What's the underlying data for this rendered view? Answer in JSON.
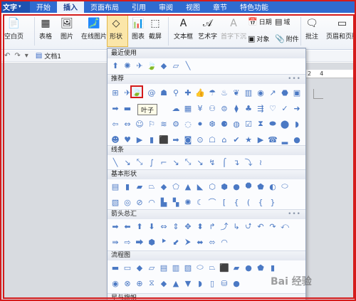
{
  "app_menu": {
    "label": "文字",
    "caret": "▾"
  },
  "menu_tabs": [
    "开始",
    "插入",
    "页面布局",
    "引用",
    "审阅",
    "视图",
    "章节",
    "特色功能"
  ],
  "active_tab": "插入",
  "ribbon": {
    "blank_page": "空白页",
    "table": "表格",
    "picture": "图片",
    "online_picture": "在线图片",
    "shape": "形状",
    "chart": "图表",
    "screenshot": "截屏",
    "textbox": "文本框",
    "art_text": "艺术字",
    "drop_cap": "首字下沉",
    "date": "日期",
    "object": "对象",
    "domain": "域",
    "attachment": "附件",
    "comment": "批注",
    "header_footer": "页眉和页脚"
  },
  "quickbar": {
    "document_tab": "文档1"
  },
  "ruler": {
    "marks": [
      "2",
      "4"
    ]
  },
  "shapes_panel": {
    "sections": {
      "recent": "最近使用",
      "recommended": "推荐",
      "lines": "线条",
      "basic": "基本形状",
      "arrows": "箭头总汇",
      "flowchart": "流程图",
      "stars": "星与旗帜"
    },
    "more_indicator": "•••",
    "tooltip": "叶子",
    "highlighted_shape": "leaf"
  },
  "watermark": "Bai 经验",
  "colors": {
    "menubar": "#2f6bd0",
    "shape_icon": "#4b79c4",
    "annotation_red": "#d41b1b"
  }
}
